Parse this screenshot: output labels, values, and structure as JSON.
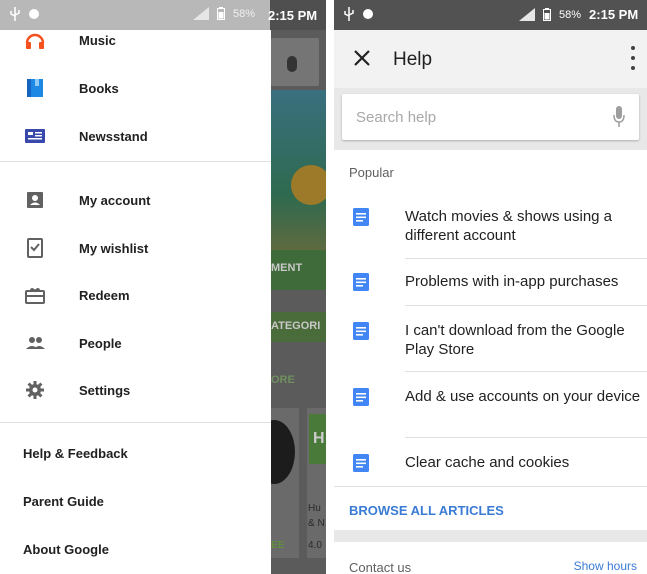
{
  "left_screen": {
    "status_bar": {
      "battery": "58%",
      "time": "2:15 PM"
    },
    "drawer": {
      "items": [
        {
          "label": "Music",
          "icon": "headphones-icon",
          "color": "#f4511e"
        },
        {
          "label": "Books",
          "icon": "book-icon",
          "color": "#1e88e5"
        },
        {
          "label": "Newsstand",
          "icon": "newsstand-icon",
          "color": "#3949ab"
        },
        {
          "label": "My account",
          "icon": "account-box-icon",
          "color": "#616161"
        },
        {
          "label": "My wishlist",
          "icon": "wishlist-icon",
          "color": "#616161"
        },
        {
          "label": "Redeem",
          "icon": "redeem-icon",
          "color": "#616161"
        },
        {
          "label": "People",
          "icon": "people-icon",
          "color": "#616161"
        },
        {
          "label": "Settings",
          "icon": "gear-icon",
          "color": "#616161"
        }
      ],
      "help_feedback": "Help & Feedback",
      "parent_guide": "Parent Guide",
      "about_google": "About Google"
    },
    "background": {
      "banner_text": "ore",
      "green_button": "MENT",
      "categories_button": "ATEGORI",
      "more_label": "ORE",
      "app_tile_letter": "H",
      "app_name_1": "Hu",
      "app_name_2": "& N",
      "rating": "4.0",
      "install_label": "EE"
    }
  },
  "right_screen": {
    "status_bar": {
      "battery": "58%",
      "time": "2:15 PM"
    },
    "toolbar": {
      "title": "Help"
    },
    "search": {
      "placeholder": "Search help"
    },
    "popular_label": "Popular",
    "articles": [
      "Watch movies & shows using a different account",
      "Problems with in-app purchases",
      "I can't download from the Google Play Store",
      "Add & use accounts on your device",
      "Clear cache and cookies"
    ],
    "browse_all": "BROWSE ALL ARTICLES",
    "contact_us": "Contact us",
    "show_hours": "Show hours"
  },
  "colors": {
    "accent_blue": "#3a7bd5",
    "doc_icon_blue": "#4285f4",
    "music_orange": "#f4511e"
  }
}
